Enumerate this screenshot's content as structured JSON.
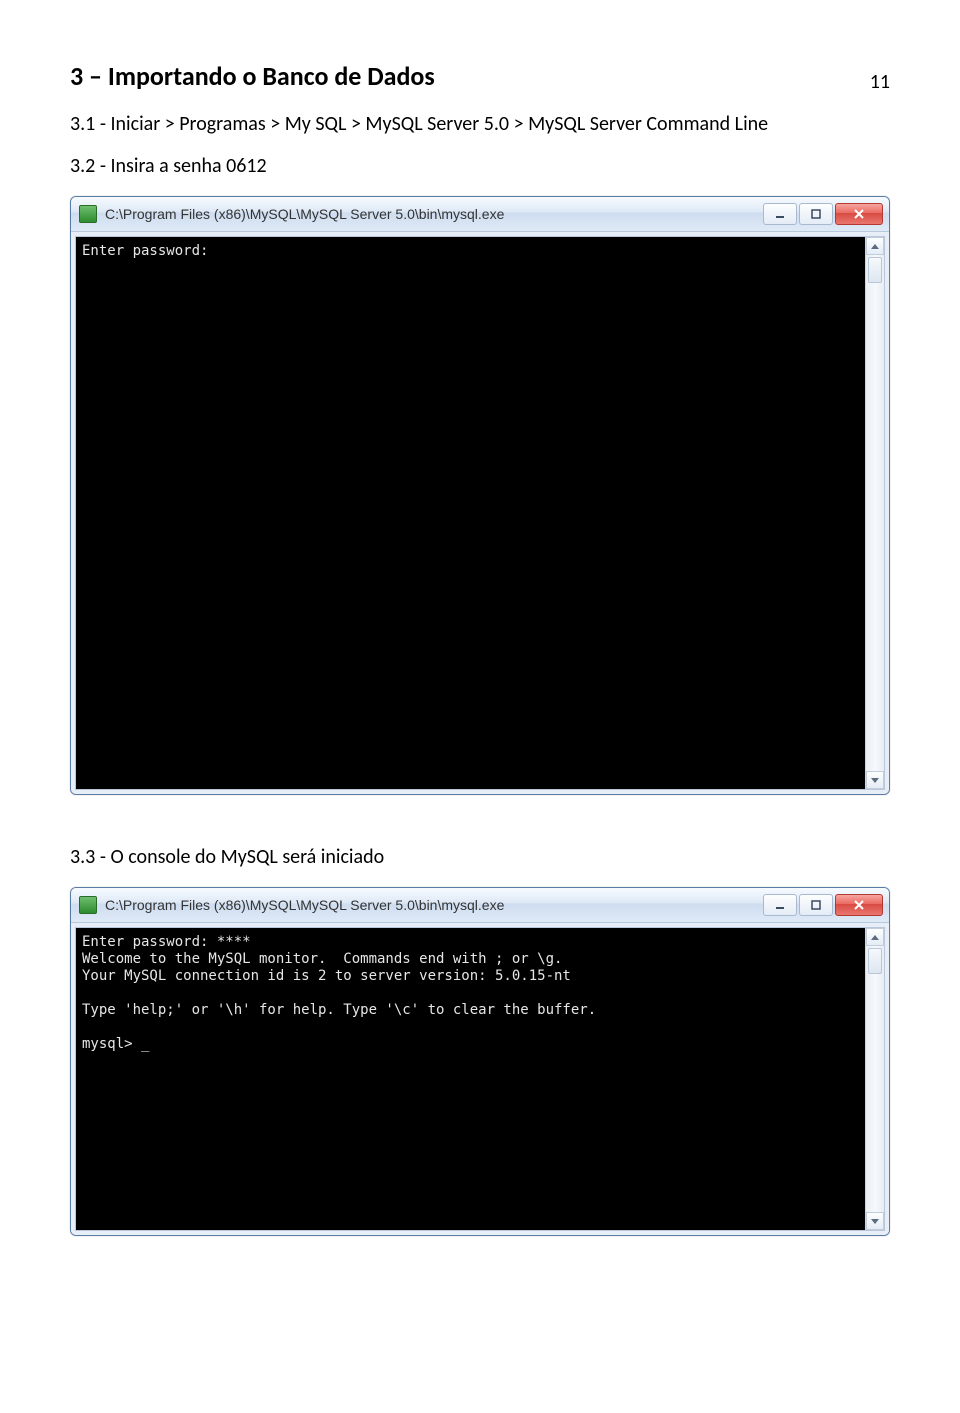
{
  "page_number": "11",
  "section_title": "3 – Importando o Banco de Dados",
  "step_1": "3.1 - Iniciar > Programas >  My SQL >  MySQL Server 5.0 >  MySQL Server Command Line",
  "step_2": "3.2 - Insira a senha 0612",
  "step_3": "3.3 - O console do MySQL será iniciado",
  "window1": {
    "title": "C:\\Program Files (x86)\\MySQL\\MySQL Server 5.0\\bin\\mysql.exe",
    "console_text": "Enter password:"
  },
  "window2": {
    "title": "C:\\Program Files (x86)\\MySQL\\MySQL Server 5.0\\bin\\mysql.exe",
    "console_text": "Enter password: ****\nWelcome to the MySQL monitor.  Commands end with ; or \\g.\nYour MySQL connection id is 2 to server version: 5.0.15-nt\n\nType 'help;' or '\\h' for help. Type '\\c' to clear the buffer.\n\nmysql> _"
  }
}
